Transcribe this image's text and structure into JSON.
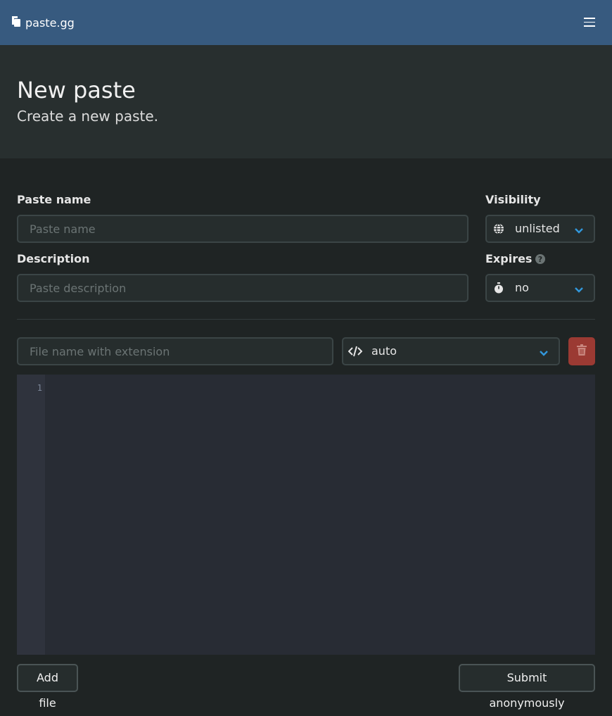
{
  "navbar": {
    "brand": "paste.gg",
    "brand_icon": "copy-icon",
    "menu_icon": "hamburger-menu-icon"
  },
  "hero": {
    "title": "New paste",
    "subtitle": "Create a new paste."
  },
  "form": {
    "paste_name_label": "Paste name",
    "paste_name_placeholder": "Paste name",
    "paste_name_value": "",
    "description_label": "Description",
    "description_placeholder": "Paste description",
    "description_value": "",
    "visibility_label": "Visibility",
    "visibility_value": "unlisted",
    "visibility_icon": "globe-icon",
    "expires_label": "Expires",
    "expires_help_icon": "question-circle-icon",
    "expires_value": "no",
    "expires_icon": "stopwatch-icon"
  },
  "file": {
    "name_placeholder": "File name with extension",
    "name_value": "",
    "language_value": "auto",
    "language_icon": "code-icon",
    "delete_icon": "trash-icon",
    "line_numbers": [
      "1"
    ],
    "content": ""
  },
  "actions": {
    "add_file": "Add file",
    "submit": "Submit anonymously"
  },
  "colors": {
    "navbar": "#375a7f",
    "hero_bg": "#282f2f",
    "page_bg": "#1f2424",
    "accent_chevron": "#3298dc",
    "danger": "#9b3a33",
    "editor_bg": "#282c34"
  }
}
